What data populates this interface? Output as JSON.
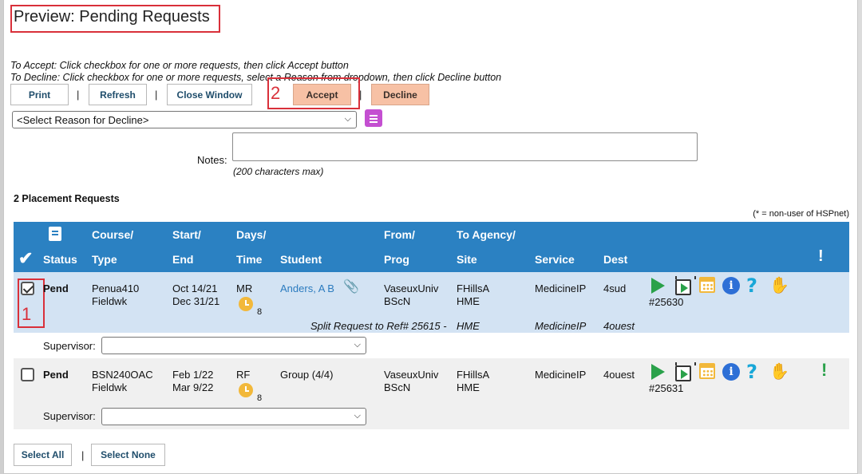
{
  "title": "Preview: Pending Requests",
  "instructions": {
    "accept": "To Accept: Click checkbox for one or more requests, then click Accept button",
    "decline": "To Decline: Click checkbox for one or more requests, select a Reason from dropdown, then click Decline button"
  },
  "toolbar": {
    "print": "Print",
    "refresh": "Refresh",
    "close": "Close Window",
    "accept": "Accept",
    "decline": "Decline",
    "separator": "|"
  },
  "annotations": {
    "one": "1",
    "two": "2"
  },
  "decline_reason": {
    "selected": "<Select Reason for Decline>"
  },
  "notes": {
    "label": "Notes:",
    "hint": "(200 characters max)"
  },
  "count_label": "2 Placement Requests",
  "nonuser_note": "(* = non-user of HSPnet)",
  "columns": {
    "status": "Status",
    "course_top": "Course/",
    "course_bottom": "Type",
    "start_top": "Start/",
    "start_bottom": "End",
    "days_top": "Days/",
    "days_bottom": "Time",
    "student": "Student",
    "from_top": "From/",
    "from_bottom": "Prog",
    "agency_top": "To Agency/",
    "agency_bottom": "Site",
    "service": "Service",
    "dest": "Dest",
    "alert": "!"
  },
  "rows": [
    {
      "checked": true,
      "status": "Pend",
      "course": "Penua410",
      "type": "Fieldwk",
      "start": "Oct 14/21",
      "end": "Dec 31/21",
      "days": "MR",
      "hours": "8",
      "student": "Anders, A B",
      "from": "VaseuxUniv",
      "prog": "BScN",
      "agency": "FHillsA",
      "site": "HME",
      "service": "MedicineIP",
      "dest": "4sud",
      "ref": "#25630",
      "split_text": "Split Request to Ref# 25615 -",
      "split_site": "HME",
      "split_service": "MedicineIP",
      "split_dest": "4ouest",
      "supervisor_label": "Supervisor:",
      "supervisor_value": ""
    },
    {
      "checked": false,
      "status": "Pend",
      "course": "BSN240OAC",
      "type": "Fieldwk",
      "start": "Feb 1/22",
      "end": "Mar 9/22",
      "days": "RF",
      "hours": "8",
      "student": "Group (4/4)",
      "from": "VaseuxUniv",
      "prog": "BScN",
      "agency": "FHillsA",
      "site": "HME",
      "service": "MedicineIP",
      "dest": "4ouest",
      "ref": "#25631",
      "alert": "!",
      "supervisor_label": "Supervisor:",
      "supervisor_value": ""
    }
  ],
  "footer": {
    "select_all": "Select All",
    "select_none": "Select None",
    "separator": "|"
  },
  "colors": {
    "header_bg": "#2b81c2",
    "highlight_row": "#d3e3f3",
    "accent_button": "#f7c1a5",
    "annotation_red": "#d9303a",
    "play_green": "#2aa14a"
  },
  "icons": [
    "book-icon",
    "checkmark-icon",
    "play-icon",
    "film-icon",
    "calendar-icon",
    "info-icon",
    "help-icon",
    "hand-icon",
    "clock-icon",
    "paperclip-icon",
    "alert-icon"
  ]
}
